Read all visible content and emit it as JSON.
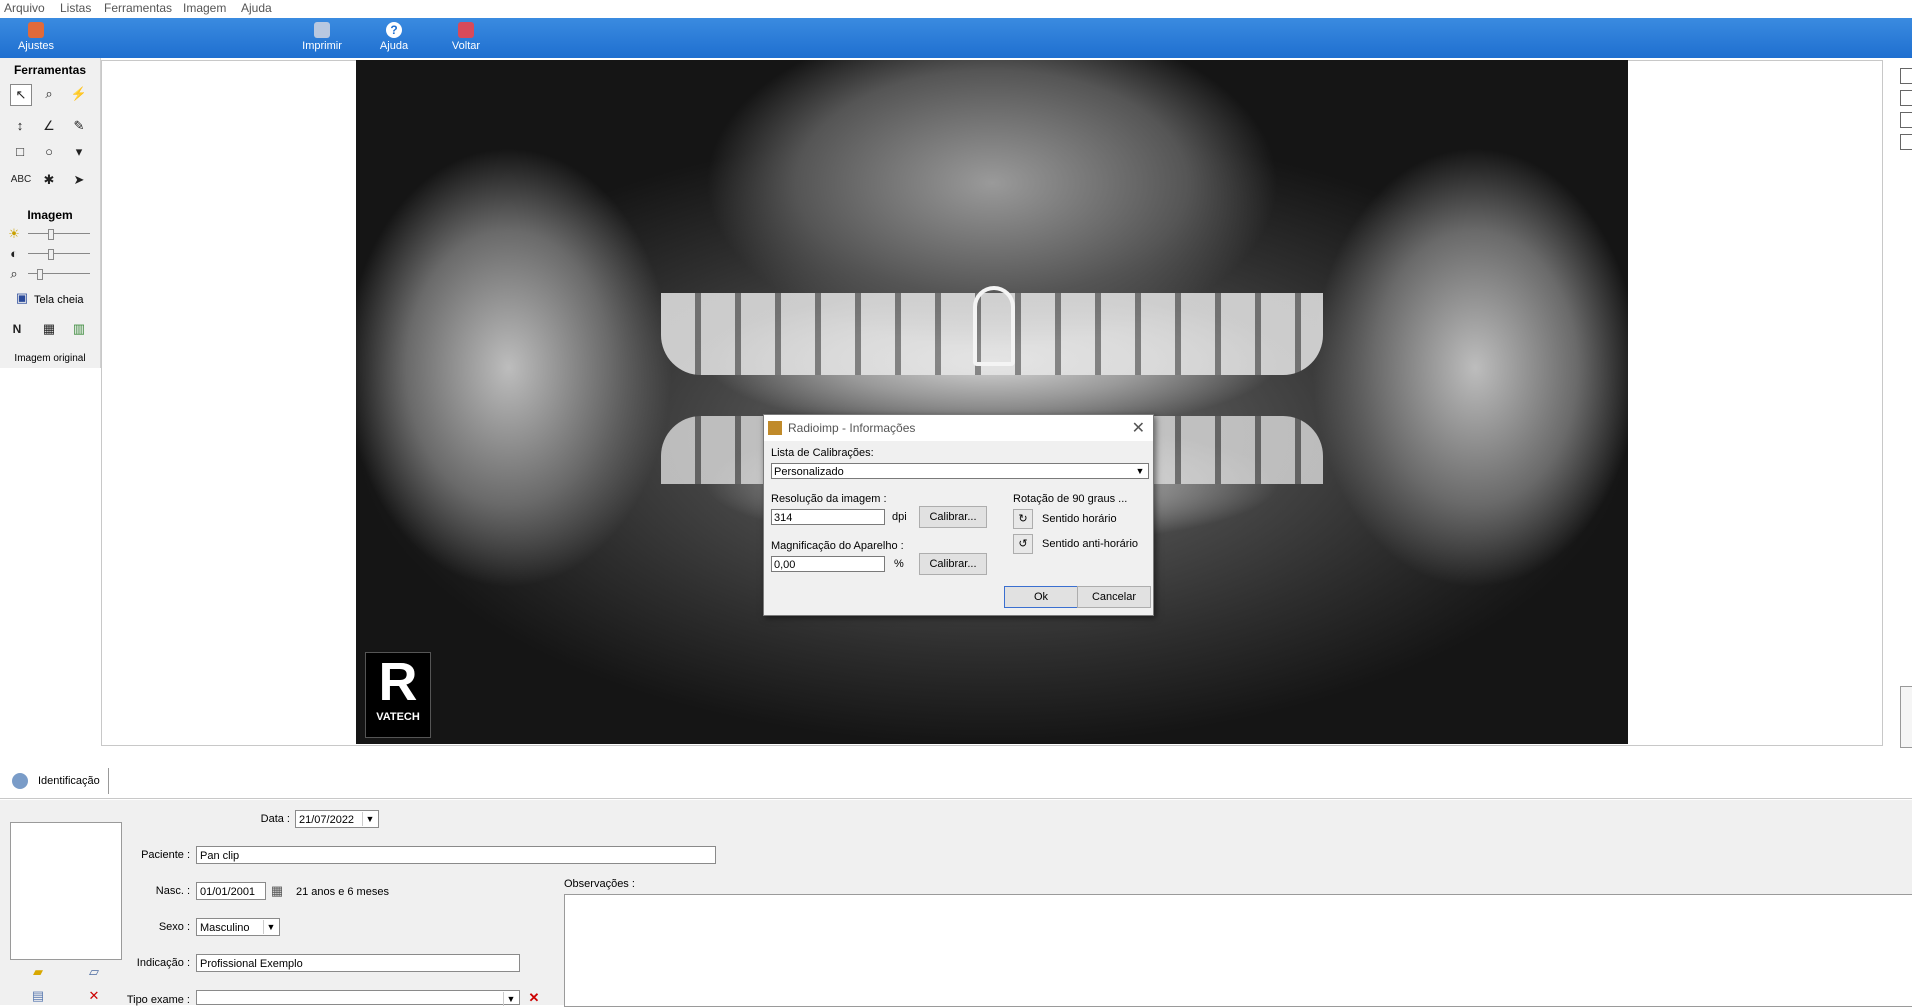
{
  "menubar": {
    "items": [
      "Arquivo",
      "Listas",
      "Ferramentas",
      "Imagem",
      "Ajuda"
    ]
  },
  "toolbar": {
    "ajustes": "Ajustes",
    "imprimir": "Imprimir",
    "ajuda": "Ajuda",
    "voltar": "Voltar"
  },
  "panel": {
    "ferramentas_title": "Ferramentas",
    "imagem_title": "Imagem",
    "tela_cheia": "Tela cheia",
    "n_label": "N",
    "abc_label": "ABC",
    "imagem_original": "Imagem original",
    "brightness_level": 0.35,
    "contrast_level": 0.35,
    "zoom_level": 0.15
  },
  "xray": {
    "logo_letter": "R",
    "logo_brand": "VATECH"
  },
  "dialog": {
    "title": "Radioimp - Informações",
    "lista_label": "Lista de Calibrações:",
    "lista_value": "Personalizado",
    "resolucao_label": "Resolução da imagem :",
    "resolucao_value": "314",
    "dpi_unit": "dpi",
    "calibrar1": "Calibrar...",
    "magnificacao_label": "Magnificação do Aparelho :",
    "magnificacao_value": "0,00",
    "pct_unit": "%",
    "calibrar2": "Calibrar...",
    "rotacao_label": "Rotação de 90 graus ...",
    "sentido_horario": "Sentido horário",
    "sentido_anti": "Sentido anti-horário",
    "ok": "Ok",
    "cancelar": "Cancelar"
  },
  "tabs": {
    "identificacao": "Identificação"
  },
  "form": {
    "data_label": "Data :",
    "data_value": "21/07/2022",
    "paciente_label": "Paciente :",
    "paciente_value": "Pan clip",
    "nasc_label": "Nasc. :",
    "nasc_value": "01/01/2001",
    "idade": "21 anos e 6 meses",
    "sexo_label": "Sexo :",
    "sexo_value": "Masculino",
    "indicacao_label": "Indicação :",
    "indicacao_value": "Profissional Exemplo",
    "tipo_label": "Tipo exame :",
    "tipo_value": "",
    "obs_label": "Observações :"
  },
  "colors": {
    "toolbar": "#1f6fd0",
    "dialog_bg": "#f0f0f0",
    "panel_bg": "#f0f0f0"
  }
}
